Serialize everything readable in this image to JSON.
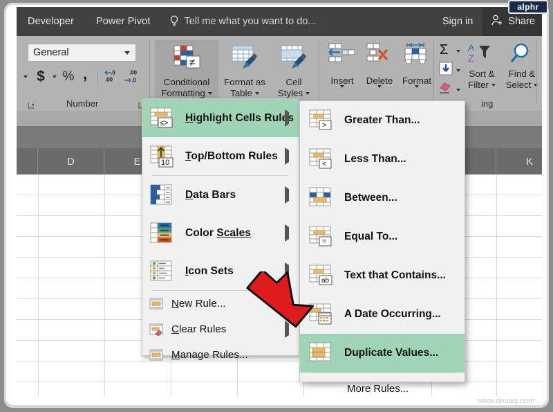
{
  "window": {
    "brand_badge": "alphr",
    "watermark": "www.deuaq.com"
  },
  "ribbon": {
    "tabs": [
      {
        "label": "Developer"
      },
      {
        "label": "Power Pivot"
      }
    ],
    "tell_me": {
      "text": "Tell me what you want to do...",
      "icon": "lightbulb-icon"
    },
    "sign_in": "Sign in",
    "share": "Share",
    "number_group": {
      "label": "Number",
      "format_value": "General",
      "currency": "$",
      "percent": "%",
      "comma": ",",
      "increase_decimal": ".00",
      "decrease_decimal": ".00"
    },
    "styles_group": {
      "conditional_formatting_line1": "Conditional",
      "conditional_formatting_line2": "Formatting",
      "format_as_table_line1": "Format as",
      "format_as_table_line2": "Table",
      "cell_styles_line1": "Cell",
      "cell_styles_line2": "Styles"
    },
    "cells_group": {
      "insert": "Insert",
      "delete": "Delete",
      "format": "Format"
    },
    "editing_group": {
      "label": "ing",
      "sort_filter_line1": "Sort &",
      "sort_filter_line2": "Filter",
      "find_select_line1": "Find &",
      "find_select_line2": "Select"
    }
  },
  "sheet": {
    "columns": [
      "D",
      "E",
      "K"
    ]
  },
  "menu_conditional_formatting": {
    "items": [
      {
        "label_pre": "H",
        "label_post": "ighlight Cells Rules",
        "icon": "highlight-cells-rules-icon",
        "submenu": true,
        "highlighted": true
      },
      {
        "label_pre": "T",
        "label_post": "op/Bottom Rules",
        "icon": "top-bottom-rules-icon",
        "submenu": true,
        "highlighted": false
      },
      {
        "label_pre": "D",
        "label_post": "ata Bars",
        "icon": "data-bars-icon",
        "submenu": true,
        "highlighted": false
      },
      {
        "label_pre": "Color ",
        "label_post": "Scales",
        "icon": "color-scales-icon",
        "submenu": true,
        "highlighted": false
      },
      {
        "label_pre": "I",
        "label_post": "con Sets",
        "icon": "icon-sets-icon",
        "submenu": true,
        "highlighted": false
      }
    ],
    "commands": [
      {
        "label_pre": "N",
        "label_post": "ew Rule...",
        "icon": "new-rule-icon",
        "submenu": false
      },
      {
        "label_pre": "C",
        "label_post": "lear Rules",
        "icon": "clear-rules-icon",
        "submenu": true
      },
      {
        "label_pre": "M",
        "label_post": "anage Rules...",
        "icon": "manage-rules-icon",
        "submenu": false
      }
    ]
  },
  "menu_highlight_cells_rules": {
    "items": [
      {
        "label_pre": "G",
        "label_post": "reater Than...",
        "icon": "greater-than-icon",
        "highlighted": false
      },
      {
        "label_pre": "L",
        "label_post": "ess Than...",
        "icon": "less-than-icon",
        "highlighted": false
      },
      {
        "label_pre": "B",
        "label_post": "etween...",
        "icon": "between-icon",
        "highlighted": false
      },
      {
        "label_pre": "E",
        "label_post": "qual To...",
        "icon": "equal-to-icon",
        "highlighted": false
      },
      {
        "label_pre": "T",
        "label_post": "ext that Contains...",
        "icon": "text-that-contains-icon",
        "highlighted": false
      },
      {
        "label_pre": "A",
        "label_post": " Date Occurring...",
        "icon": "a-date-occurring-icon",
        "highlighted": false
      },
      {
        "label_pre": "D",
        "label_post": "uplicate Values...",
        "icon": "duplicate-values-icon",
        "highlighted": true
      }
    ],
    "more_rules": {
      "label_pre": "M",
      "label_post": "ore Rules..."
    }
  },
  "annotation": {
    "arrow": "red-arrow-pointing-to-duplicate-values"
  },
  "colors": {
    "highlight_green": "#9fd4b6",
    "ribbon_gray": "#b3b3b3",
    "titlebar_dark": "#414141",
    "arrow_red": "#e01b1b"
  }
}
